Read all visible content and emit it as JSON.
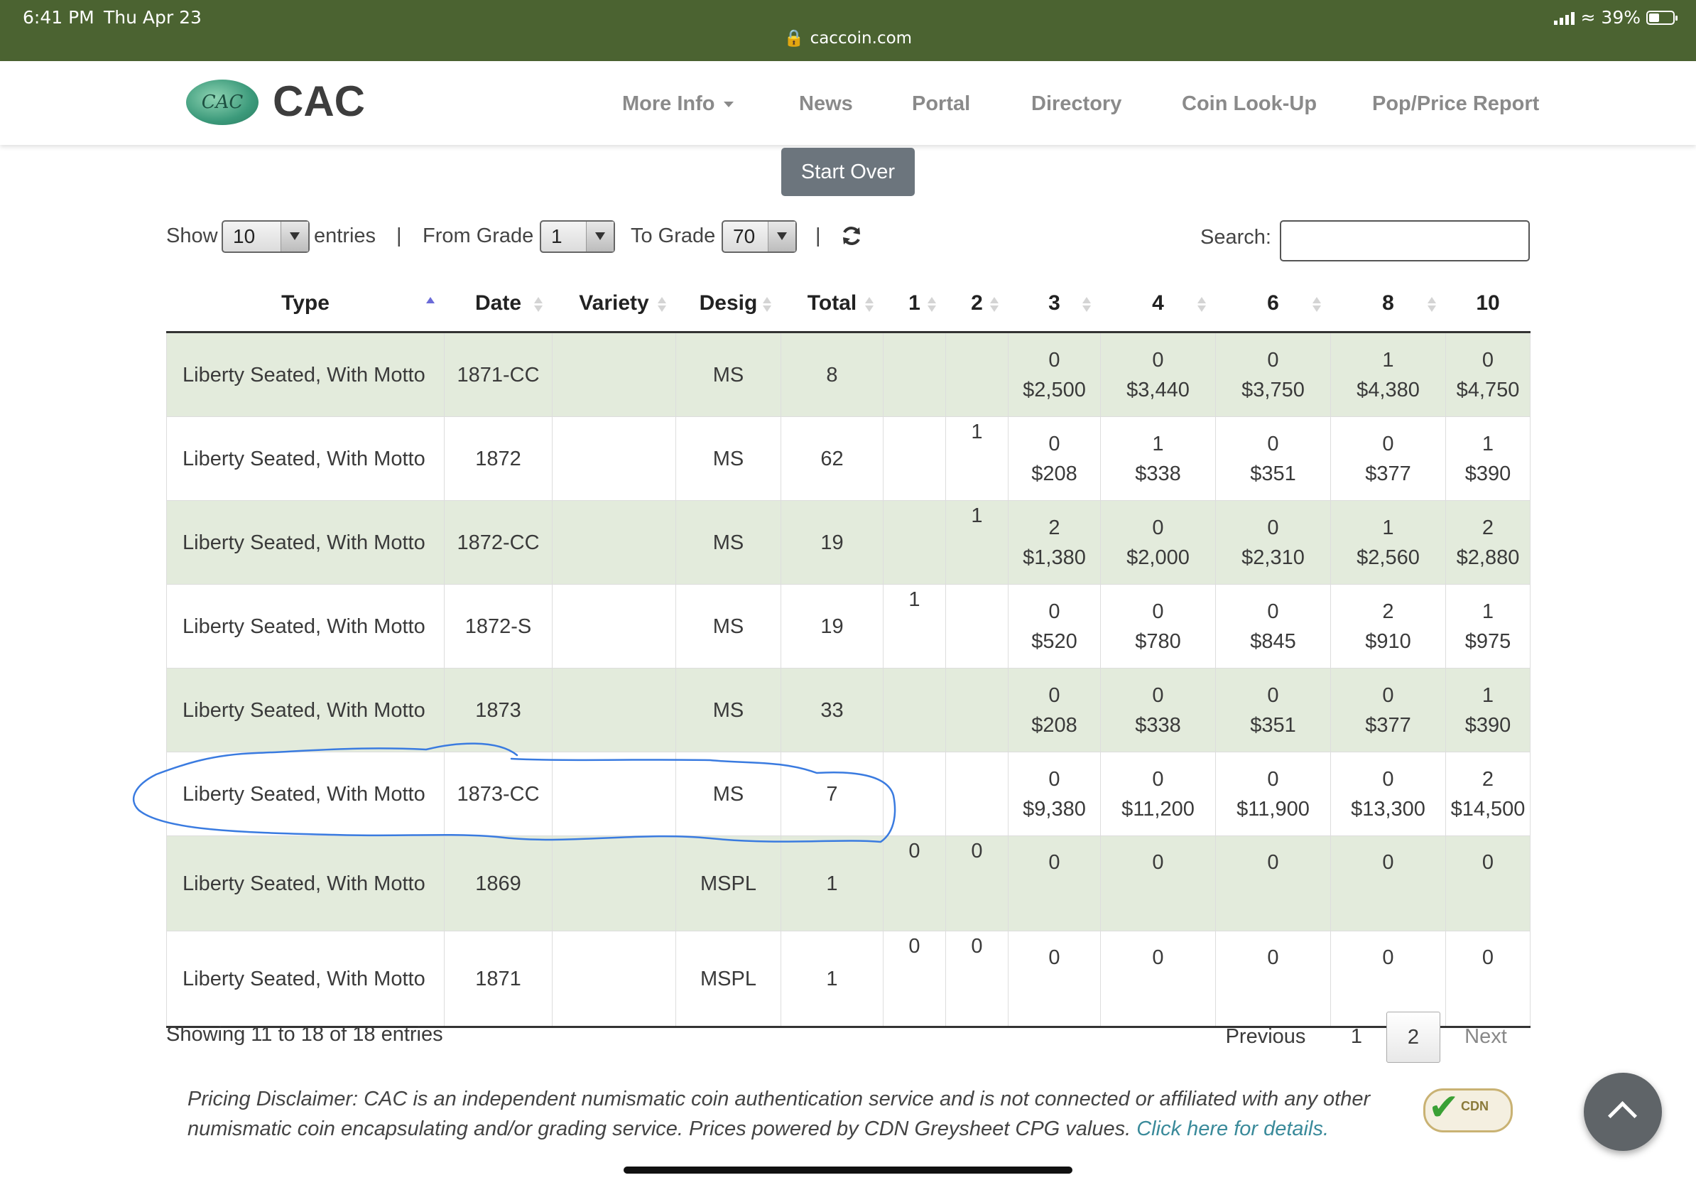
{
  "status_bar": {
    "time": "6:41 PM",
    "date": "Thu Apr 23",
    "url": "caccoin.com",
    "battery": "39%"
  },
  "site": {
    "brand": "CAC",
    "logo_text": "CAC",
    "nav": [
      "More Info",
      "News",
      "Portal",
      "Directory",
      "Coin Look-Up",
      "Pop/Price Report"
    ]
  },
  "actions": {
    "start_over": "Start Over"
  },
  "controls": {
    "show_label": "Show",
    "entries_value": "10",
    "entries_label": "entries",
    "separator": "|",
    "from_grade_label": "From Grade",
    "from_grade_value": "1",
    "to_grade_label": "To Grade",
    "to_grade_value": "70",
    "search_label": "Search:",
    "search_value": ""
  },
  "table": {
    "columns": [
      "Type",
      "Date",
      "Variety",
      "Desig",
      "Total",
      "1",
      "2",
      "3",
      "4",
      "6",
      "8",
      "10"
    ],
    "rows": [
      {
        "type": "Liberty Seated, With Motto",
        "date": "1871-CC",
        "variety": "",
        "desig": "MS",
        "total": "8",
        "g1": "",
        "g2": "",
        "g3": [
          "0",
          "$2,500"
        ],
        "g4": [
          "0",
          "$3,440"
        ],
        "g6": [
          "0",
          "$3,750"
        ],
        "g8": [
          "1",
          "$4,380"
        ],
        "g10": [
          "0",
          "$4,750"
        ]
      },
      {
        "type": "Liberty Seated, With Motto",
        "date": "1872",
        "variety": "",
        "desig": "MS",
        "total": "62",
        "g1": "",
        "g2": "1",
        "g3": [
          "0",
          "$208"
        ],
        "g4": [
          "1",
          "$338"
        ],
        "g6": [
          "0",
          "$351"
        ],
        "g8": [
          "0",
          "$377"
        ],
        "g10": [
          "1",
          "$390"
        ]
      },
      {
        "type": "Liberty Seated, With Motto",
        "date": "1872-CC",
        "variety": "",
        "desig": "MS",
        "total": "19",
        "g1": "",
        "g2": "1",
        "g3": [
          "2",
          "$1,380"
        ],
        "g4": [
          "0",
          "$2,000"
        ],
        "g6": [
          "0",
          "$2,310"
        ],
        "g8": [
          "1",
          "$2,560"
        ],
        "g10": [
          "2",
          "$2,880"
        ]
      },
      {
        "type": "Liberty Seated, With Motto",
        "date": "1872-S",
        "variety": "",
        "desig": "MS",
        "total": "19",
        "g1": "1",
        "g2": "",
        "g3": [
          "0",
          "$520"
        ],
        "g4": [
          "0",
          "$780"
        ],
        "g6": [
          "0",
          "$845"
        ],
        "g8": [
          "2",
          "$910"
        ],
        "g10": [
          "1",
          "$975"
        ]
      },
      {
        "type": "Liberty Seated, With Motto",
        "date": "1873",
        "variety": "",
        "desig": "MS",
        "total": "33",
        "g1": "",
        "g2": "",
        "g3": [
          "0",
          "$208"
        ],
        "g4": [
          "0",
          "$338"
        ],
        "g6": [
          "0",
          "$351"
        ],
        "g8": [
          "0",
          "$377"
        ],
        "g10": [
          "1",
          "$390"
        ]
      },
      {
        "type": "Liberty Seated, With Motto",
        "date": "1873-CC",
        "variety": "",
        "desig": "MS",
        "total": "7",
        "g1": "",
        "g2": "",
        "g3": [
          "0",
          "$9,380"
        ],
        "g4": [
          "0",
          "$11,200"
        ],
        "g6": [
          "0",
          "$11,900"
        ],
        "g8": [
          "0",
          "$13,300"
        ],
        "g10": [
          "2",
          "$14,500"
        ]
      },
      {
        "type": "Liberty Seated, With Motto",
        "date": "1869",
        "variety": "",
        "desig": "MSPL",
        "total": "1",
        "g1": "0",
        "g2": "0",
        "g3": [
          "0",
          ""
        ],
        "g4": [
          "0",
          ""
        ],
        "g6": [
          "0",
          ""
        ],
        "g8": [
          "0",
          ""
        ],
        "g10": [
          "0",
          ""
        ]
      },
      {
        "type": "Liberty Seated, With Motto",
        "date": "1871",
        "variety": "",
        "desig": "MSPL",
        "total": "1",
        "g1": "0",
        "g2": "0",
        "g3": [
          "0",
          ""
        ],
        "g4": [
          "0",
          ""
        ],
        "g6": [
          "0",
          ""
        ],
        "g8": [
          "0",
          ""
        ],
        "g10": [
          "0",
          ""
        ]
      }
    ]
  },
  "pagination": {
    "info": "Showing 11 to 18 of 18 entries",
    "previous": "Previous",
    "pages": [
      "1",
      "2"
    ],
    "current": "2",
    "next": "Next"
  },
  "disclaimer": {
    "text": "Pricing Disclaimer: CAC is an independent numismatic coin authentication service and is not connected or affiliated with any other numismatic coin encapsulating and/or grading service. Prices powered by CDN Greysheet CPG values.",
    "link": "Click here for details.",
    "badge": "CDN"
  },
  "colors": {
    "status_bar": "#4b6331",
    "row_stripe": "#e3ebdc",
    "start_over": "#6c757d",
    "link": "#3a8a9a",
    "annotation": "#3a7be0"
  }
}
